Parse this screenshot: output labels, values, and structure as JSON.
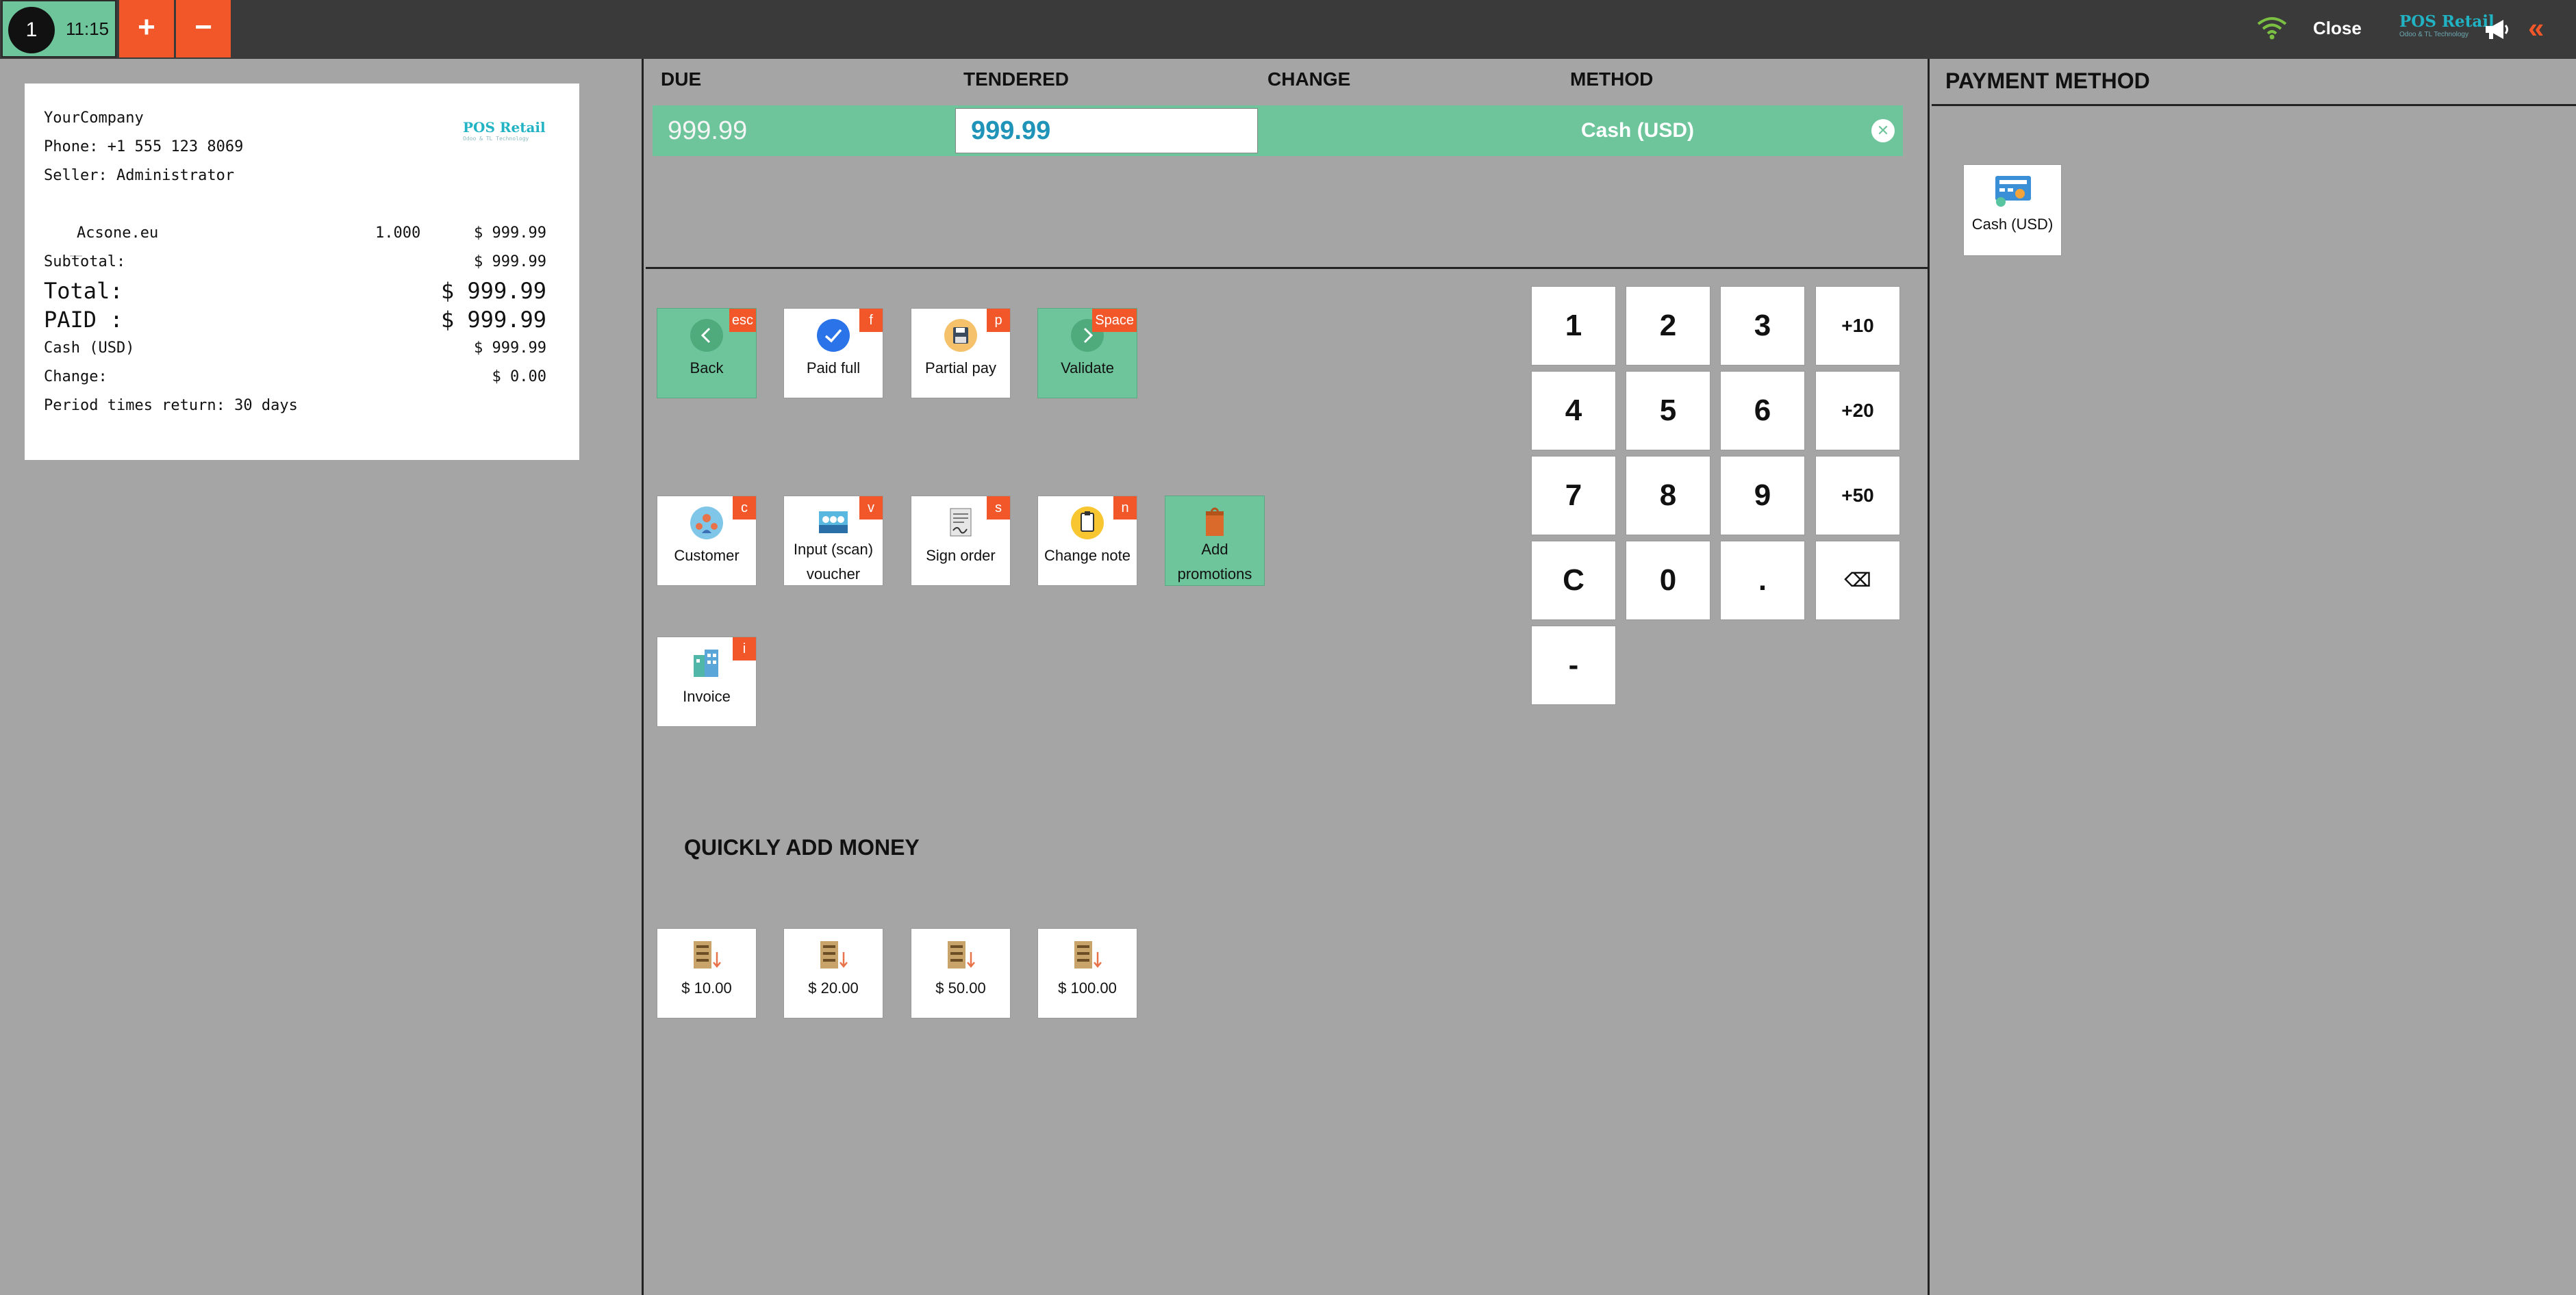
{
  "topbar": {
    "order_number": "1",
    "order_time": "11:15",
    "add_order_label": "+",
    "remove_order_label": "−",
    "close_label": "Close",
    "logo_text": "POS Retail",
    "logo_tagline": "Odoo & TL Technology"
  },
  "receipt": {
    "company": "YourCompany",
    "phone": "Phone: +1 555 123 8069",
    "seller": "Seller: Administrator",
    "logo_text": "POS Retail",
    "logo_tagline": "Odoo & TL Technology",
    "line_item": {
      "name": "Acsone.eu",
      "qty": "1.000",
      "price": "$ 999.99"
    },
    "subtotal_label": "Subtotal:",
    "subtotal_value": "$ 999.99",
    "total_label": "Total:",
    "total_value": "$ 999.99",
    "paid_label": "PAID :",
    "paid_value": "$ 999.99",
    "cash_label": "Cash (USD)",
    "cash_value": "$ 999.99",
    "change_label": "Change:",
    "change_value": "$ 0.00",
    "return_policy": "Period times return: 30 days"
  },
  "paymentlines": {
    "headers": {
      "due": "DUE",
      "tendered": "TENDERED",
      "change": "CHANGE",
      "method": "METHOD"
    },
    "line": {
      "due": "999.99",
      "tendered": "999.99",
      "change": "",
      "method": "Cash (USD)"
    }
  },
  "actions": {
    "back": {
      "label": "Back",
      "key": "esc"
    },
    "paid_full": {
      "label": "Paid full",
      "key": "f"
    },
    "partial_pay": {
      "label": "Partial pay",
      "key": "p"
    },
    "validate": {
      "label": "Validate",
      "key": "Space"
    },
    "customer": {
      "label": "Customer",
      "key": "c"
    },
    "voucher": {
      "label1": "Input (scan)",
      "label2": "voucher",
      "key": "v"
    },
    "sign_order": {
      "label": "Sign order",
      "key": "s"
    },
    "change_note": {
      "label": "Change note",
      "key": "n"
    },
    "promotions": {
      "label1": "Add",
      "label2": "promotions"
    },
    "invoice": {
      "label": "Invoice",
      "key": "i"
    }
  },
  "quick_money": {
    "title": "QUICKLY ADD MONEY",
    "amounts": [
      "$ 10.00",
      "$ 20.00",
      "$ 50.00",
      "$ 100.00"
    ]
  },
  "numpad": {
    "keys": [
      "1",
      "2",
      "3",
      "+10",
      "4",
      "5",
      "6",
      "+20",
      "7",
      "8",
      "9",
      "+50",
      "C",
      "0",
      ".",
      "⌫",
      "-"
    ]
  },
  "payment_method": {
    "title": "PAYMENT METHOD",
    "methods": [
      "Cash (USD)"
    ]
  },
  "colors": {
    "topbar": "#3a3a3a",
    "background": "#a5a5a5",
    "accent_green": "#6ec59c",
    "accent_orange": "#f2572a",
    "tendered_text": "#1f93b8"
  },
  "icons": {
    "wifi": "wifi-icon",
    "megaphone": "megaphone-icon",
    "collapse": "double-chevron-left-icon"
  }
}
